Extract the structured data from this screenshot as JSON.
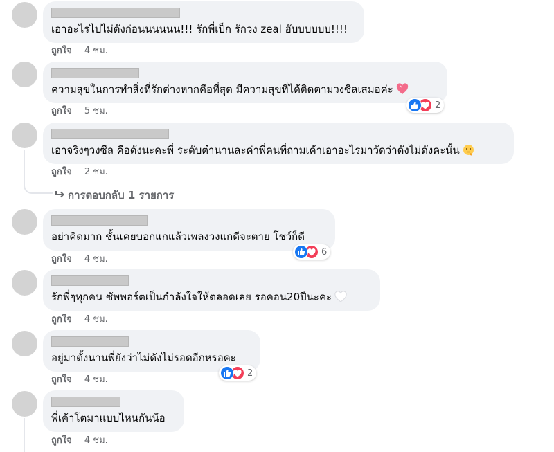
{
  "colors": {
    "bubble_bg": "#f0f2f5",
    "meta_text": "#65676b",
    "like_blue": "#1877f2",
    "love_red": "#f33e58"
  },
  "comments": [
    {
      "text": "เอาอะไรไปไม่ดังก่อนนนนนน!!! รักพี่เป็ก รักวง zeal ฮับบบบบบ!!!!",
      "like_label": "ถูกใจ",
      "time": "4 ชม."
    },
    {
      "text": "ความสุขในการทำสิ่งที่รักต่างหากคือที่สุด มีความสุขที่ได้ติดตามวงซีลเสมอค่ะ",
      "emoji": "heart-icon",
      "like_label": "ถูกใจ",
      "time": "5 ชม.",
      "reaction_count": "2"
    },
    {
      "text": "เอาจริงๆวงซีล คือดังนะคะพี่ ระดับตำนานละค่าพี่คนที่ถามเค้าเอาอะไรมาวัดว่าดังไม่ดังคะนั้น",
      "emoji": "thinking-face-icon",
      "like_label": "ถูกใจ",
      "time": "2 ชม.",
      "replies_label": "การตอบกลับ 1 รายการ"
    },
    {
      "text": "อย่าคิดมาก ชั้นเคยบอกแกแล้วเพลงวงแกดีจะตาย โชว์ก็ดี",
      "like_label": "ถูกใจ",
      "time": "4 ชม.",
      "reaction_count": "6"
    },
    {
      "text": "รักพี่ๆทุกคน ซัพพอร์ตเป็นกำลังใจให้ตลอดเลย รอคอน20ปีนะคะ",
      "emoji": "white-heart-icon",
      "like_label": "ถูกใจ",
      "time": "4 ชม."
    },
    {
      "text": "อยู่มาตั้งนานพี่ยังว่าไม่ดังไม่รอดอีกหรอคะ",
      "like_label": "ถูกใจ",
      "time": "4 ชม.",
      "reaction_count": "2"
    },
    {
      "text": "พี่เค้าโตมาแบบไหนกันน้อ",
      "like_label": "ถูกใจ",
      "time": "4 ชม."
    }
  ]
}
